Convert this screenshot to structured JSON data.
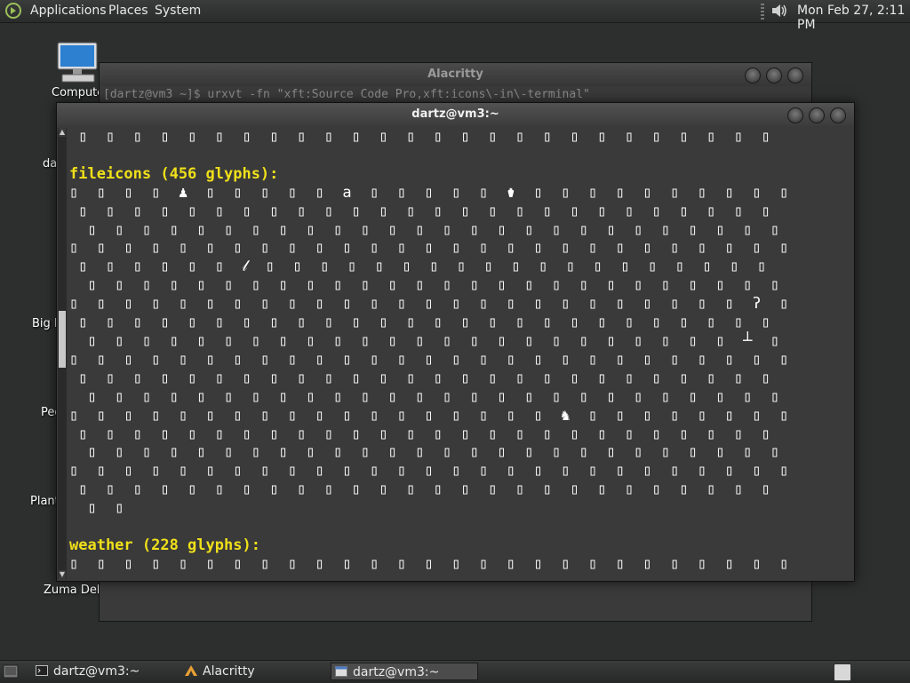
{
  "top_panel": {
    "menus": [
      "Applications",
      "Places",
      "System"
    ],
    "clock": "Mon Feb 27,  2:11 PM"
  },
  "desktop": {
    "icons": [
      {
        "label": "Compute",
        "icon": "computer-icon"
      },
      {
        "label": "da",
        "icon": "home-folder-icon"
      },
      {
        "label": "Big M",
        "icon": "game-icon"
      },
      {
        "label": "Peg",
        "icon": "game-icon"
      },
      {
        "label": "Plant",
        "icon": "game-icon"
      },
      {
        "label": "Zuma Delu",
        "icon": "game-icon"
      }
    ]
  },
  "alacritty": {
    "title": "Alacritty",
    "command_line": "[dartz@vm3 ~]$ urxvt -fn \"xft:Source Code Pro,xft:icons\\-in\\-terminal\""
  },
  "urxvt": {
    "title": "dartz@vm3:~",
    "lines": [
      {
        "type": "glyphs",
        "indent": 1,
        "count": 26
      },
      {
        "type": "blank"
      },
      {
        "type": "header",
        "text": "fileicons (456 glyphs):"
      },
      {
        "type": "glyphs",
        "indent": 0,
        "count": 27,
        "specials": {
          "4": "♟",
          "10": "a",
          "16": "⚱"
        }
      },
      {
        "type": "glyphs",
        "indent": 1,
        "count": 26
      },
      {
        "type": "glyphs",
        "indent": 2,
        "count": 26
      },
      {
        "type": "glyphs",
        "indent": 0,
        "count": 27
      },
      {
        "type": "glyphs",
        "indent": 1,
        "count": 26,
        "specials": {
          "6": "𝓁"
        }
      },
      {
        "type": "glyphs",
        "indent": 2,
        "count": 26
      },
      {
        "type": "glyphs",
        "indent": 0,
        "count": 27,
        "specials": {
          "25": "ʔ"
        }
      },
      {
        "type": "glyphs",
        "indent": 1,
        "count": 26
      },
      {
        "type": "glyphs",
        "indent": 2,
        "count": 26,
        "specials": {
          "24": "┴"
        }
      },
      {
        "type": "glyphs",
        "indent": 0,
        "count": 27
      },
      {
        "type": "glyphs",
        "indent": 1,
        "count": 26
      },
      {
        "type": "glyphs",
        "indent": 2,
        "count": 26
      },
      {
        "type": "glyphs",
        "indent": 0,
        "count": 27,
        "specials": {
          "18": "♞"
        }
      },
      {
        "type": "glyphs",
        "indent": 1,
        "count": 26
      },
      {
        "type": "glyphs",
        "indent": 2,
        "count": 26
      },
      {
        "type": "glyphs",
        "indent": 0,
        "count": 27
      },
      {
        "type": "glyphs",
        "indent": 1,
        "count": 26
      },
      {
        "type": "glyphs",
        "indent": 2,
        "count": 2
      },
      {
        "type": "blank"
      },
      {
        "type": "header",
        "text": "weather (228 glyphs):"
      },
      {
        "type": "glyphs",
        "indent": 0,
        "count": 27
      }
    ]
  },
  "taskbar": {
    "tasks": [
      {
        "label": "dartz@vm3:~",
        "icon": "terminal-icon",
        "active": false
      },
      {
        "label": "Alacritty",
        "icon": "alacritty-icon",
        "active": false
      },
      {
        "label": "dartz@vm3:~",
        "icon": "window-icon",
        "active": true
      }
    ]
  }
}
